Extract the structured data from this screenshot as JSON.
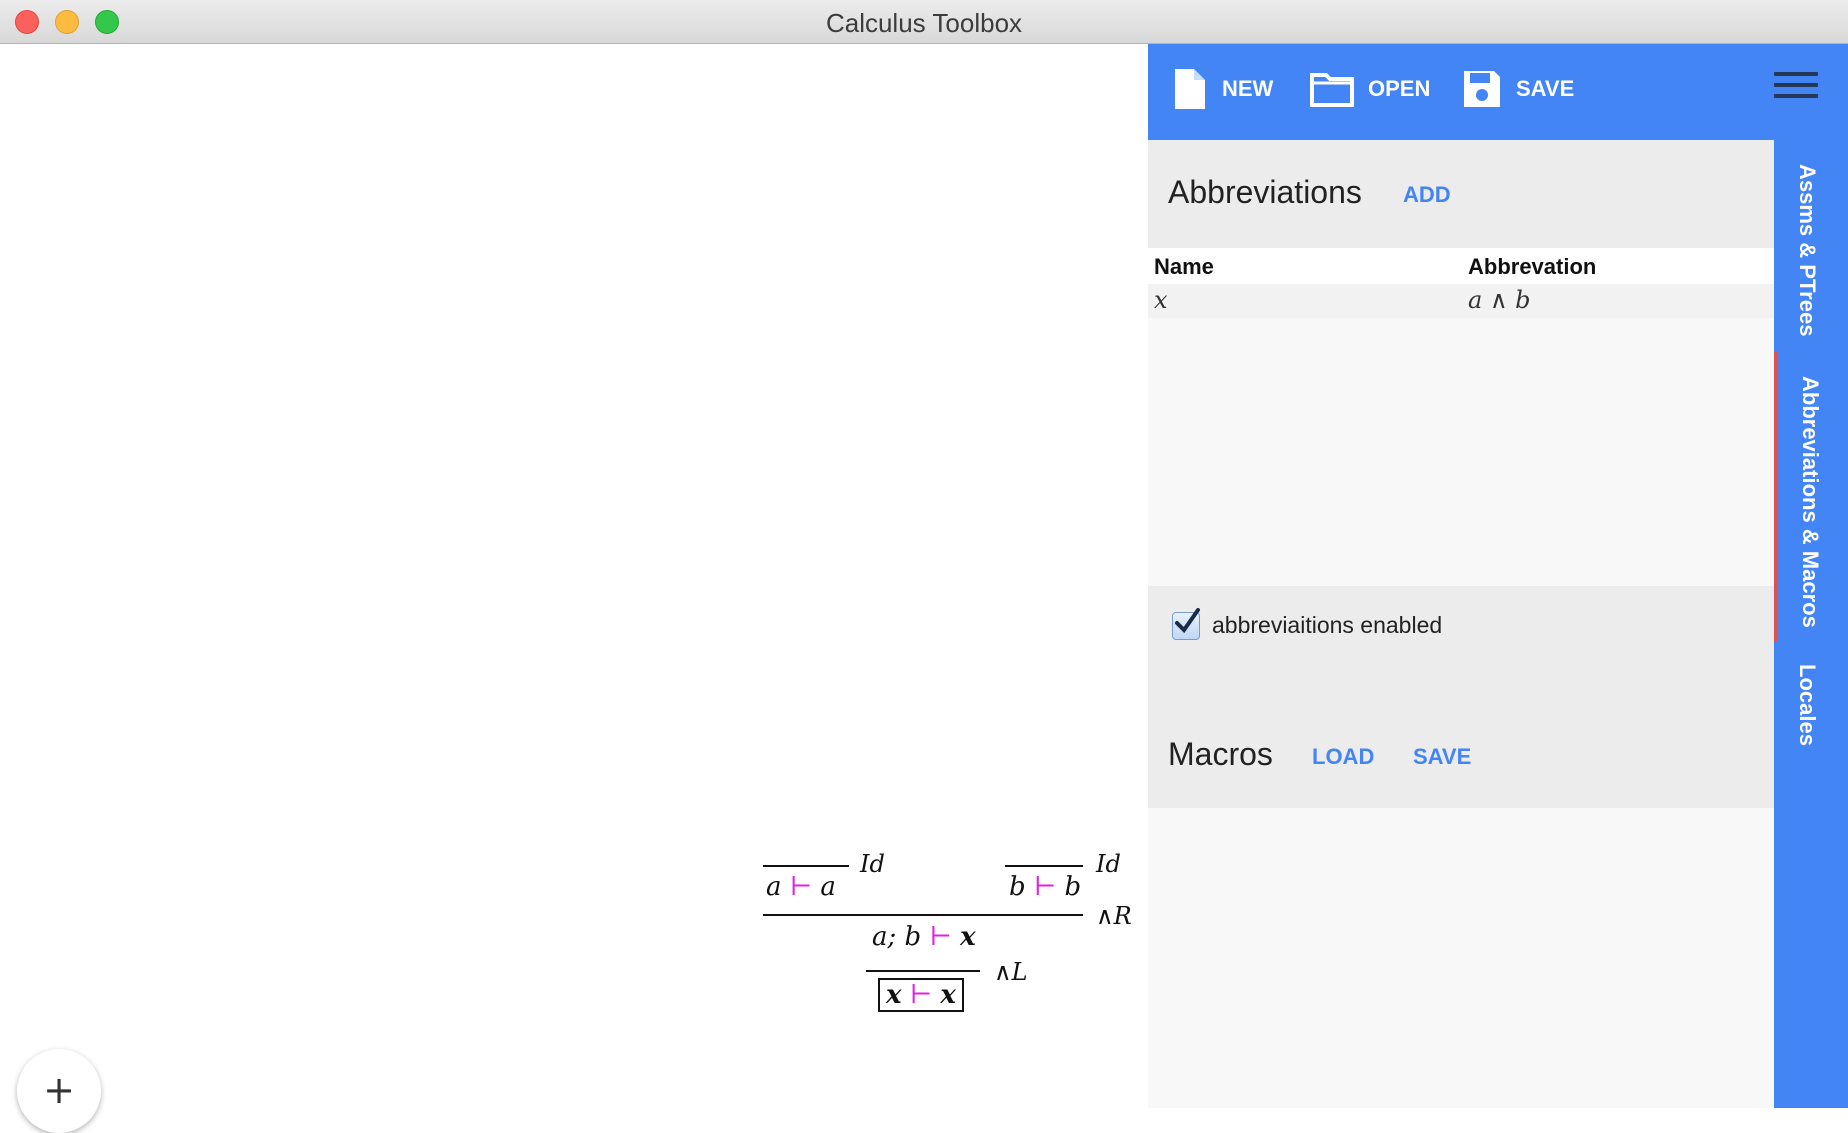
{
  "window": {
    "title": "Calculus Toolbox"
  },
  "toolbar": {
    "new_label": "NEW",
    "open_label": "OPEN",
    "save_label": "SAVE"
  },
  "abbreviations": {
    "title": "Abbreviations",
    "add_label": "ADD",
    "columns": [
      "Name",
      "Abbrevation"
    ],
    "rows": [
      {
        "name": "x",
        "abbreviation": "a ∧ b"
      }
    ],
    "enabled_label": "abbreviaitions enabled",
    "enabled": true
  },
  "macros": {
    "title": "Macros",
    "load_label": "LOAD",
    "save_label": "SAVE"
  },
  "side_tabs": [
    {
      "label": "Assms & PTrees",
      "active": false
    },
    {
      "label": "Abbreviations & Macros",
      "active": true
    },
    {
      "label": "Locales",
      "active": false
    }
  ],
  "proof_tree": {
    "left_leaf": {
      "lhs": "a",
      "turnstile": "⊢",
      "rhs": "a",
      "rule": "Id"
    },
    "right_leaf": {
      "lhs": "b",
      "turnstile": "⊢",
      "rhs": "b",
      "rule": "Id"
    },
    "middle": {
      "lhs": "a; b",
      "turnstile": "⊢",
      "rhs": "x",
      "rule": "∧R"
    },
    "root": {
      "lhs": "x",
      "turnstile": "⊢",
      "rhs": "x",
      "rule": "∧L"
    }
  },
  "fab": {
    "label": "+"
  },
  "colors": {
    "accent": "#4385f5",
    "turnstile": "#e020e0",
    "active_tab_marker": "#e05050"
  }
}
